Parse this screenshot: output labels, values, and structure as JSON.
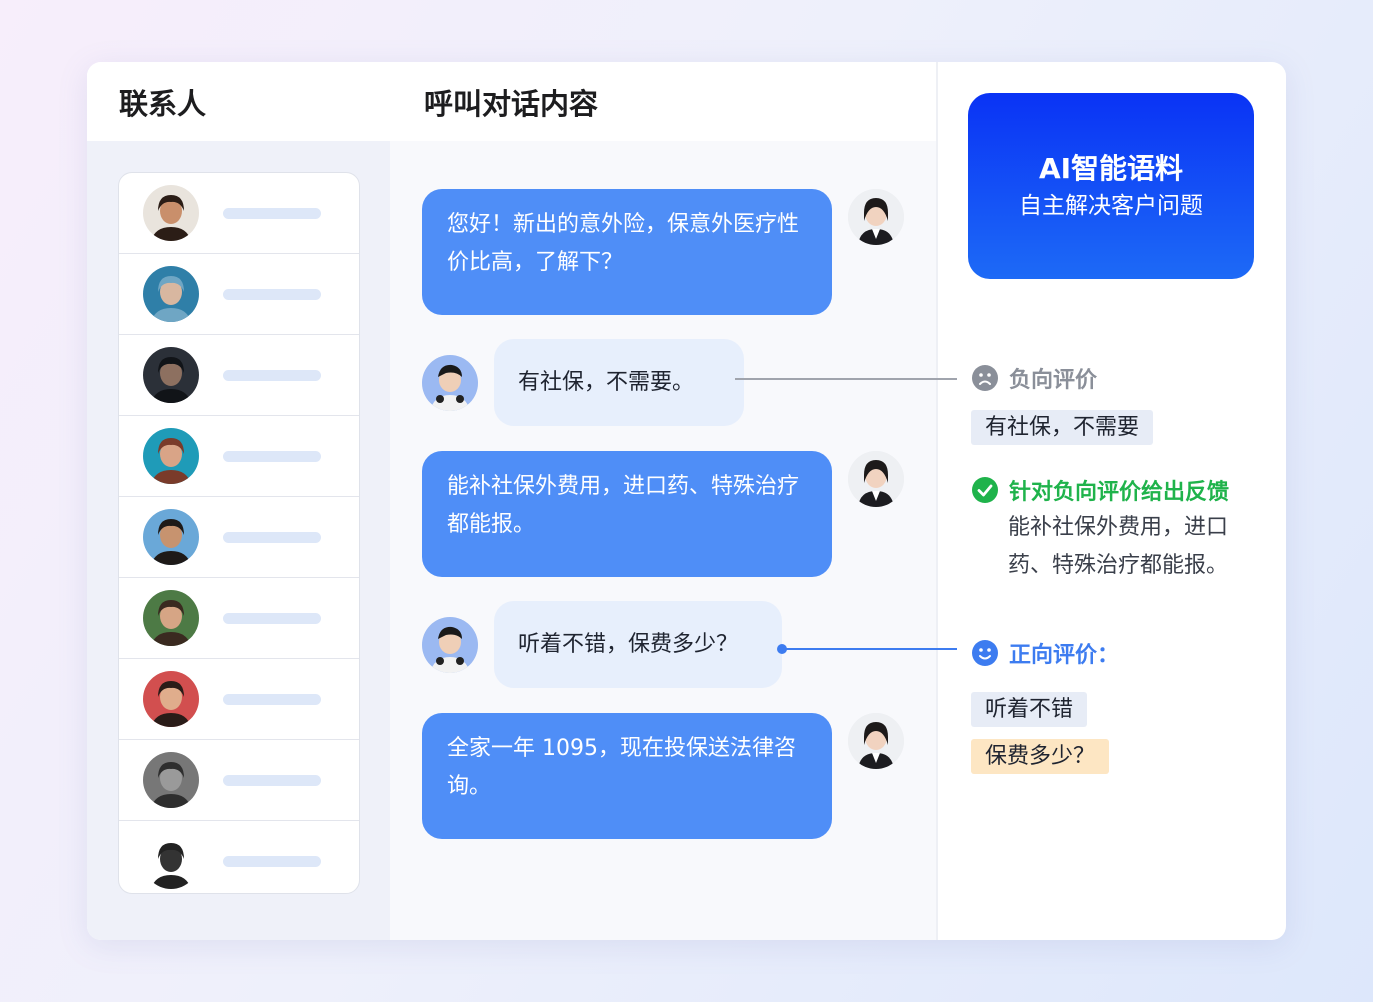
{
  "contacts": {
    "header": "联系人",
    "avatars": [
      {
        "name": "contact-1",
        "skin": "#c98f6b",
        "hair": "#2b1d16",
        "bg": "#e9e4dd"
      },
      {
        "name": "contact-2",
        "skin": "#d8b7a0",
        "hair": "#6fa6c4",
        "bg": "#2f7fa8"
      },
      {
        "name": "contact-3",
        "skin": "#8d7060",
        "hair": "#111418",
        "bg": "#2b3038"
      },
      {
        "name": "contact-4",
        "skin": "#d9a487",
        "hair": "#7a3b2a",
        "bg": "#1f9bb8"
      },
      {
        "name": "contact-5",
        "skin": "#c7936f",
        "hair": "#1e1a18",
        "bg": "#6aa8d8"
      },
      {
        "name": "contact-6",
        "skin": "#d6a585",
        "hair": "#3a2a20",
        "bg": "#4d7a45"
      },
      {
        "name": "contact-7",
        "skin": "#e0ad8c",
        "hair": "#2a1c18",
        "bg": "#d24f4f"
      },
      {
        "name": "contact-8",
        "skin": "#9a9a9a",
        "hair": "#2e2e2e",
        "bg": "#777777"
      },
      {
        "name": "contact-9",
        "skin": "#333333",
        "hair": "#222222",
        "bg": "#ffffff"
      }
    ]
  },
  "chat": {
    "header": "呼叫对话内容",
    "messages": [
      {
        "role": "agent",
        "text": "您好！新出的意外险，保意外医疗性价比高，了解下？"
      },
      {
        "role": "customer",
        "text": "有社保，不需要。"
      },
      {
        "role": "agent",
        "text": "能补社保外费用，进口药、特殊治疗都能报。"
      },
      {
        "role": "customer",
        "text": "听着不错，保费多少？"
      },
      {
        "role": "agent",
        "text": "全家一年 1095，现在投保送法律咨询。"
      }
    ]
  },
  "ai_card": {
    "title": "AI智能语料",
    "subtitle": "自主解决客户问题"
  },
  "analysis": {
    "negative": {
      "label": "负向评价",
      "tag": "有社保，不需要"
    },
    "feedback": {
      "label": "针对负向评价给出反馈",
      "text": "能补社保外费用，进口药、特殊治疗都能报。"
    },
    "positive": {
      "label": "正向评价：",
      "tags": [
        "听着不错",
        "保费多少？"
      ]
    }
  },
  "colors": {
    "agent_bubble": "#4f8ef7",
    "customer_bubble": "#e7effc",
    "negative": "#8a8f99",
    "feedback": "#1fb34b",
    "positive": "#3d7cf0",
    "ai_card_top": "#0a33f5"
  }
}
